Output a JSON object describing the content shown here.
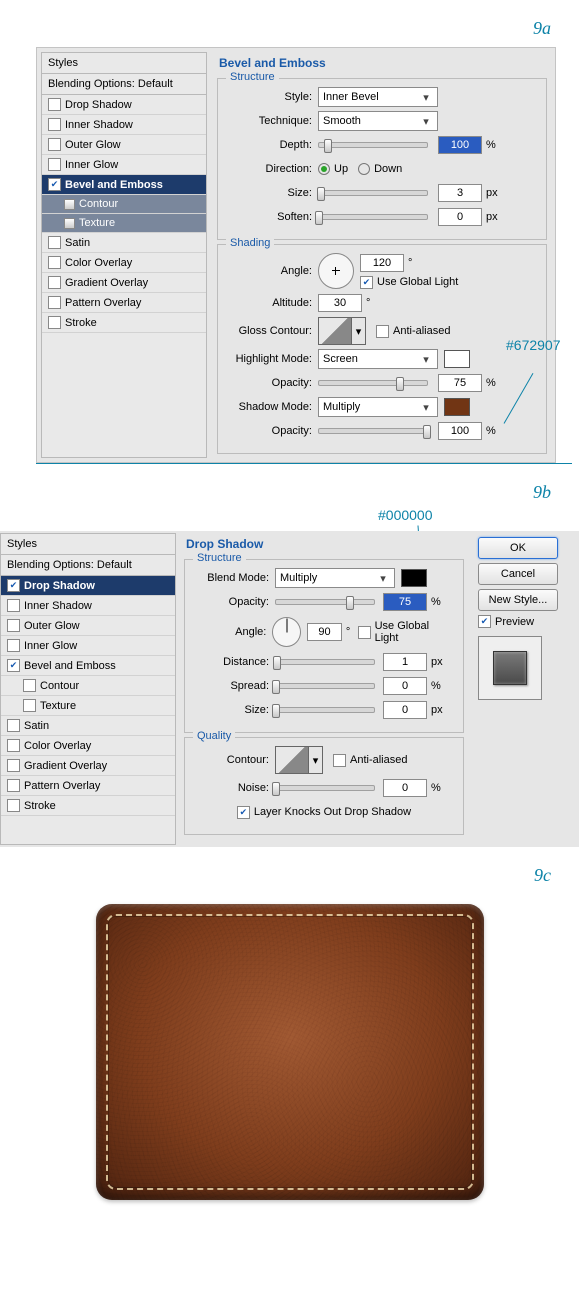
{
  "steps": {
    "a": "9a",
    "b": "9b",
    "c": "9c"
  },
  "annot": {
    "shadow_color": "#672907",
    "drop_color": "#000000"
  },
  "panelA": {
    "styles_header": "Styles",
    "blending_default": "Blending Options: Default",
    "items": [
      "Drop Shadow",
      "Inner Shadow",
      "Outer Glow",
      "Inner Glow",
      "Bevel and Emboss",
      "Contour",
      "Texture",
      "Satin",
      "Color Overlay",
      "Gradient Overlay",
      "Pattern Overlay",
      "Stroke"
    ],
    "title": "Bevel and Emboss",
    "structure_legend": "Structure",
    "style_lbl": "Style:",
    "style_val": "Inner Bevel",
    "technique_lbl": "Technique:",
    "technique_val": "Smooth",
    "depth_lbl": "Depth:",
    "depth_val": "100",
    "pct": "%",
    "direction_lbl": "Direction:",
    "dir_up": "Up",
    "dir_down": "Down",
    "size_lbl": "Size:",
    "size_val": "3",
    "px": "px",
    "soften_lbl": "Soften:",
    "soften_val": "0",
    "shading_legend": "Shading",
    "angle_lbl": "Angle:",
    "angle_val": "120",
    "deg": "°",
    "global_light": "Use Global Light",
    "altitude_lbl": "Altitude:",
    "altitude_val": "30",
    "gloss_lbl": "Gloss Contour:",
    "antialiased": "Anti-aliased",
    "highlight_mode_lbl": "Highlight Mode:",
    "highlight_mode_val": "Screen",
    "opacity_lbl": "Opacity:",
    "highlight_opacity": "75",
    "shadow_mode_lbl": "Shadow Mode:",
    "shadow_mode_val": "Multiply",
    "shadow_opacity": "100",
    "highlight_color": "#ffffff",
    "shadow_color": "#713514"
  },
  "panelB": {
    "styles_header": "Styles",
    "blending_default": "Blending Options: Default",
    "items": [
      "Drop Shadow",
      "Inner Shadow",
      "Outer Glow",
      "Inner Glow",
      "Bevel and Emboss",
      "Contour",
      "Texture",
      "Satin",
      "Color Overlay",
      "Gradient Overlay",
      "Pattern Overlay",
      "Stroke"
    ],
    "title": "Drop Shadow",
    "structure_legend": "Structure",
    "blend_mode_lbl": "Blend Mode:",
    "blend_mode_val": "Multiply",
    "blend_color": "#000000",
    "opacity_lbl": "Opacity:",
    "opacity_val": "75",
    "pct": "%",
    "angle_lbl": "Angle:",
    "angle_val": "90",
    "deg": "°",
    "global_light": "Use Global Light",
    "distance_lbl": "Distance:",
    "distance_val": "1",
    "px": "px",
    "spread_lbl": "Spread:",
    "spread_val": "0",
    "size_lbl": "Size:",
    "size_val": "0",
    "quality_legend": "Quality",
    "contour_lbl": "Contour:",
    "antialiased": "Anti-aliased",
    "noise_lbl": "Noise:",
    "noise_val": "0",
    "knockout": "Layer Knocks Out Drop Shadow",
    "ok": "OK",
    "cancel": "Cancel",
    "new_style": "New Style...",
    "preview": "Preview"
  }
}
